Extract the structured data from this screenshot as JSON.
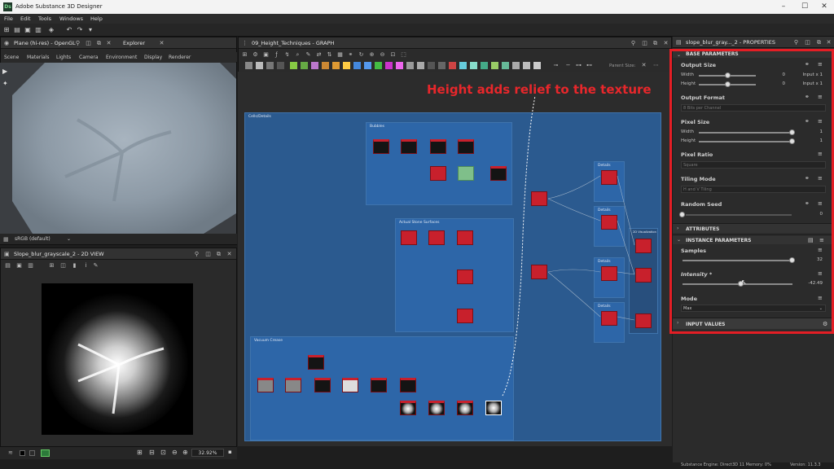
{
  "window": {
    "title": "Adobe Substance 3D Designer",
    "app_icon": "Ds"
  },
  "menu": [
    "File",
    "Edit",
    "Tools",
    "Windows",
    "Help"
  ],
  "viewport3d": {
    "title": "Plane (hi-res) - OpenGL",
    "explorer_tab": "Explorer",
    "subnav": [
      "Scene",
      "Materials",
      "Lights",
      "Camera",
      "Environment",
      "Display",
      "Renderer"
    ],
    "colorspace": "sRGB (default)"
  },
  "view2d": {
    "title": "Slope_blur_grayscale_2 - 2D VIEW",
    "zoom": "32.92%"
  },
  "graph": {
    "title": "09_Height_Techniques - GRAPH",
    "parent_size_label": "Parent Size:",
    "annotation": "Height adds relief to the texture",
    "frames": {
      "main": "Cells/Details",
      "top": "Bubbles",
      "mid": "Actual Stone Surfaces",
      "bottom": "Vacuum Crease",
      "right": "2D Visualization",
      "r1": "Details",
      "r2": "Details",
      "r3": "Details",
      "r4": "Details"
    }
  },
  "properties": {
    "title": "slope_blur_gray..._2 - PROPERTIES",
    "base_parameters": "BASE PARAMETERS",
    "output_size": {
      "label": "Output Size",
      "width_label": "Width",
      "height_label": "Height",
      "width_value": "0",
      "height_value": "0",
      "width_mode": "Input x 1",
      "height_mode": "Input x 1",
      "width_fraction": 0.5,
      "height_fraction": 0.5
    },
    "output_format": {
      "label": "Output Format",
      "value": "8 Bits per Channel"
    },
    "pixel_size": {
      "label": "Pixel Size",
      "width_label": "Width",
      "height_label": "Height",
      "width_value": "1",
      "height_value": "1"
    },
    "pixel_ratio": {
      "label": "Pixel Ratio",
      "value": "Square"
    },
    "tiling_mode": {
      "label": "Tiling Mode",
      "value": "H and V Tiling"
    },
    "random_seed": {
      "label": "Random Seed",
      "value": "0"
    },
    "attributes": "ATTRIBUTES",
    "instance_parameters": "INSTANCE PARAMETERS",
    "samples": {
      "label": "Samples",
      "value": "32"
    },
    "intensity": {
      "label": "Intensity *",
      "value": "-42.49"
    },
    "mode": {
      "label": "Mode",
      "value": "Max"
    },
    "input_values": "INPUT VALUES"
  },
  "status": {
    "engine": "Substance Engine: Direct3D 11  Memory: 0%",
    "version": "Version: 11.3.3"
  },
  "colors": {
    "accent_red": "#e41e25",
    "frame_blue": "#2e5d93",
    "node_red": "#c8202c"
  }
}
